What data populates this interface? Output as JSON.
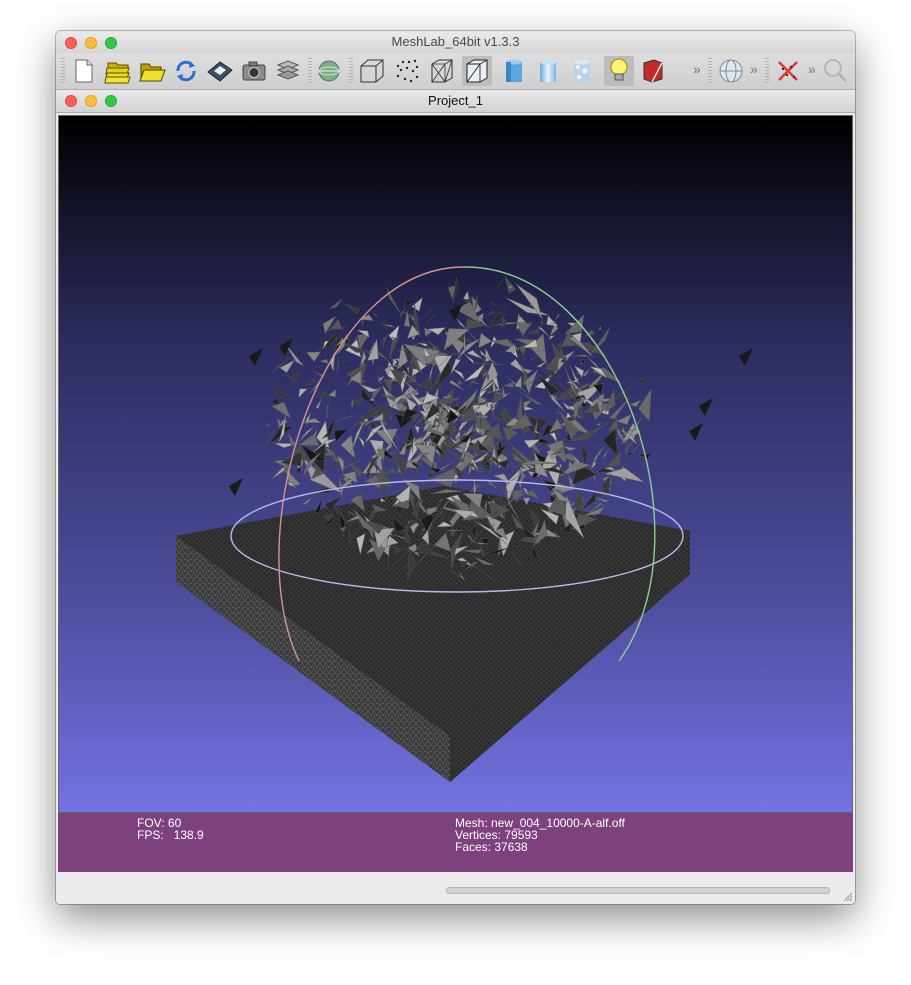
{
  "app": {
    "title": "MeshLab_64bit v1.3.3"
  },
  "document": {
    "title": "Project_1"
  },
  "toolbar": {
    "buttons": [
      {
        "name": "new-project",
        "icon": "new-document-icon"
      },
      {
        "name": "open-project",
        "icon": "open-folder-stack-icon"
      },
      {
        "name": "import-mesh",
        "icon": "open-folder-icon"
      },
      {
        "name": "reload",
        "icon": "reload-icon"
      },
      {
        "name": "export-mesh",
        "icon": "save-disk-icon"
      },
      {
        "name": "snapshot",
        "icon": "camera-icon"
      },
      {
        "name": "layers",
        "icon": "layers-icon"
      },
      {
        "name": "raster",
        "icon": "globe-image-icon"
      },
      {
        "name": "bounding-box",
        "icon": "bbox-cube-icon"
      },
      {
        "name": "points",
        "icon": "points-icon"
      },
      {
        "name": "wireframe",
        "icon": "wireframe-icon"
      },
      {
        "name": "hidden-lines",
        "icon": "hidden-lines-icon"
      },
      {
        "name": "flat",
        "icon": "flat-shading-icon"
      },
      {
        "name": "smooth",
        "icon": "smooth-shading-icon"
      },
      {
        "name": "texture",
        "icon": "texture-icon"
      },
      {
        "name": "lighting",
        "icon": "light-bulb-icon"
      },
      {
        "name": "backface",
        "icon": "backface-icon"
      }
    ],
    "overflow_label": "»"
  },
  "viewport": {
    "background_top": "#000000",
    "background_bottom": "#7373e3",
    "trackball_colors": [
      "#d99292",
      "#8fd08f",
      "#b8b8f0"
    ]
  },
  "info": {
    "fov": "FOV: 60",
    "fps": "FPS:   138.9",
    "mesh": "Mesh: new_004_10000-A-alf.off",
    "vertices": "Vertices: 79593",
    "faces": "Faces: 37638",
    "background": "#7d417e"
  }
}
